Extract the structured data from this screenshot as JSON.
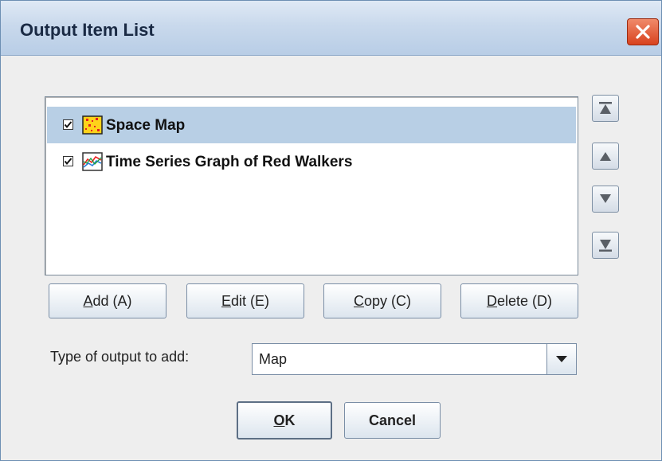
{
  "window": {
    "title": "Output Item List"
  },
  "list": {
    "items": [
      {
        "label": "Space Map",
        "checked": true,
        "selected": true,
        "icon": "space-map-icon"
      },
      {
        "label": "Time Series Graph of Red Walkers",
        "checked": true,
        "selected": false,
        "icon": "time-series-graph-icon"
      }
    ]
  },
  "buttons": {
    "add": {
      "mnemonic": "A",
      "rest": "dd (A)"
    },
    "edit": {
      "mnemonic": "E",
      "rest": "dit (E)"
    },
    "copy": {
      "mnemonic": "C",
      "rest": "opy (C)"
    },
    "delete": {
      "mnemonic": "D",
      "rest": "elete (D)"
    },
    "ok": {
      "mnemonic": "O",
      "rest": "K"
    },
    "cancel": "Cancel"
  },
  "type_select": {
    "label": "Type of output to add:",
    "value": "Map"
  },
  "colors": {
    "accent": "#b8cfe5",
    "close": "#d8421e"
  }
}
